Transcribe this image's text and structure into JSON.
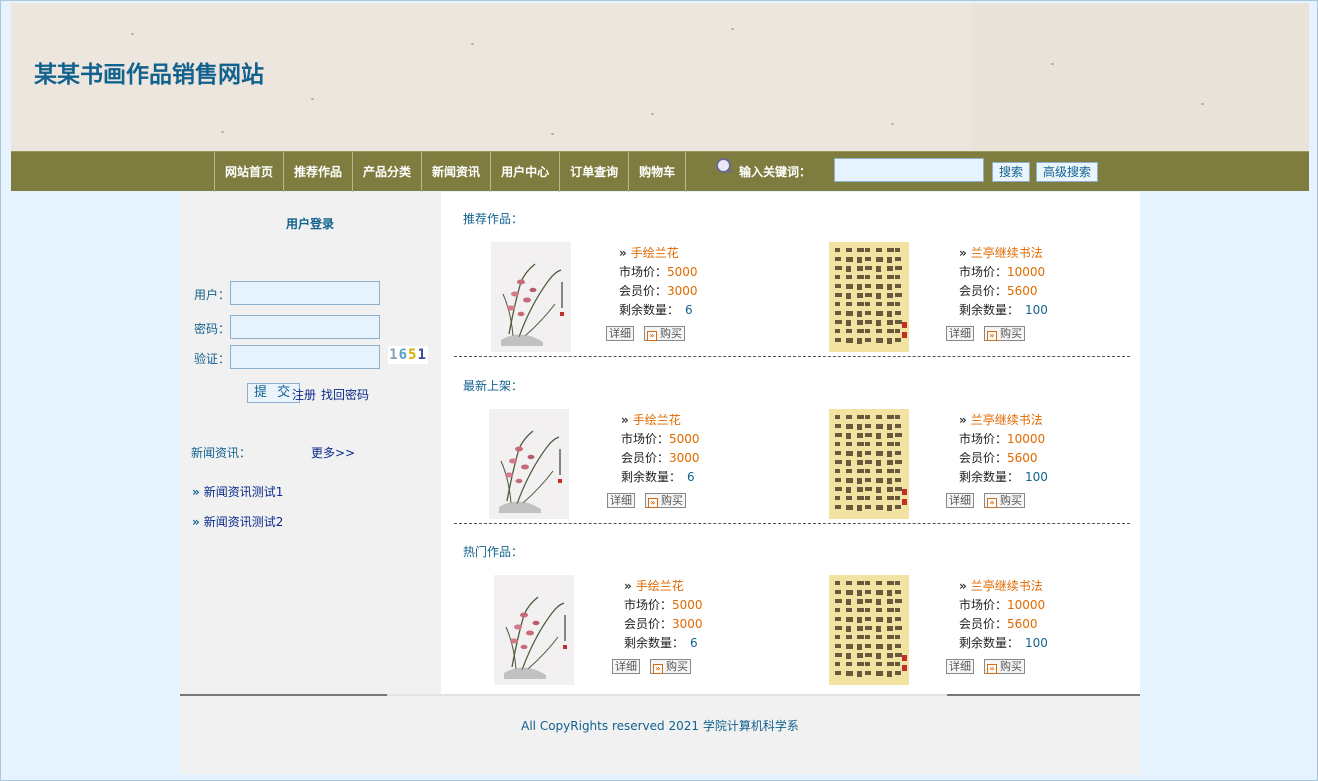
{
  "site": {
    "title": "某某书画作品销售网站"
  },
  "nav": {
    "items": [
      "网站首页",
      "推荐作品",
      "产品分类",
      "新闻资讯",
      "用户中心",
      "订单查询",
      "购物车"
    ],
    "keyword_label": "输入关键词：",
    "search_value": "",
    "search_button": "搜索",
    "advanced_button": "高级搜索"
  },
  "login": {
    "title": "用户登录",
    "user_label": "用户：",
    "password_label": "密码：",
    "verify_label": "验证：",
    "captcha": [
      "1",
      "6",
      "5",
      "1"
    ],
    "submit": "提 交",
    "register": "注册",
    "recover": "找回密码"
  },
  "news": {
    "label": "新闻资讯：",
    "more": "更多>>",
    "items": [
      "新闻资讯测试1",
      "新闻资讯测试2"
    ]
  },
  "sections": [
    {
      "title": "推荐作品：",
      "products": [
        {
          "name": "手绘兰花",
          "market_label": "市场价：",
          "market": "5000",
          "member_label": "会员价：",
          "member": "3000",
          "stock_label": "剩余数量：",
          "stock": "6",
          "detail": "详细",
          "buy": "购买",
          "image": "orchid"
        },
        {
          "name": "兰亭继续书法",
          "market_label": "市场价：",
          "market": "10000",
          "member_label": "会员价：",
          "member": "5600",
          "stock_label": "剩余数量：",
          "stock": "100",
          "detail": "详细",
          "buy": "购买",
          "image": "calligraphy"
        }
      ]
    },
    {
      "title": "最新上架：",
      "products": [
        {
          "name": "手绘兰花",
          "market_label": "市场价：",
          "market": "5000",
          "member_label": "会员价：",
          "member": "3000",
          "stock_label": "剩余数量：",
          "stock": "6",
          "detail": "详细",
          "buy": "购买",
          "image": "orchid"
        },
        {
          "name": "兰亭继续书法",
          "market_label": "市场价：",
          "market": "10000",
          "member_label": "会员价：",
          "member": "5600",
          "stock_label": "剩余数量：",
          "stock": "100",
          "detail": "详细",
          "buy": "购买",
          "image": "calligraphy"
        }
      ]
    },
    {
      "title": "热门作品：",
      "products": [
        {
          "name": "手绘兰花",
          "market_label": "市场价：",
          "market": "5000",
          "member_label": "会员价：",
          "member": "3000",
          "stock_label": "剩余数量：",
          "stock": "6",
          "detail": "详细",
          "buy": "购买",
          "image": "orchid"
        },
        {
          "name": "兰亭继续书法",
          "market_label": "市场价：",
          "market": "10000",
          "member_label": "会员价：",
          "member": "5600",
          "stock_label": "剩余数量：",
          "stock": "100",
          "detail": "详细",
          "buy": "购买",
          "image": "calligraphy"
        }
      ]
    }
  ],
  "footer": {
    "text": "All CopyRights reserved 2021 学院计算机科学系"
  },
  "colors": {
    "nav_bg": "#7e7d3f",
    "title": "#12628e",
    "price": "#e06a00",
    "page_bg": "#e6f2fd"
  }
}
